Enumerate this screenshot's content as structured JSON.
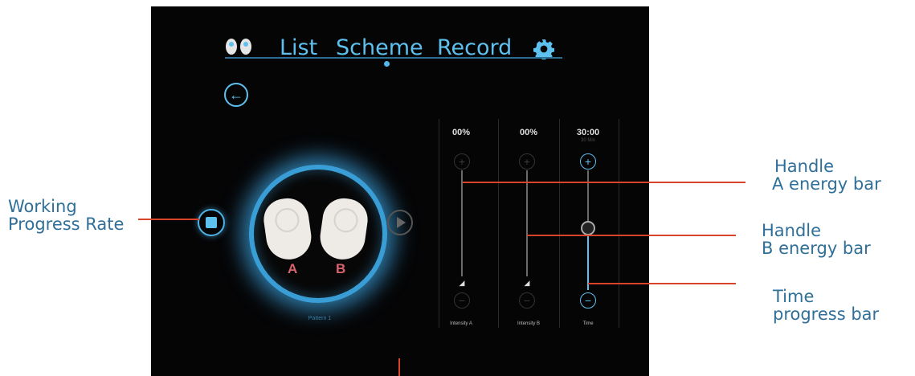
{
  "nav": {
    "pads_icon": "pads-icon",
    "items": [
      "List",
      "Scheme",
      "Record"
    ],
    "settings_icon": "gear-icon"
  },
  "back_icon": "arrow-left-icon",
  "handles": {
    "a_label": "A",
    "b_label": "B"
  },
  "plan_label": "Pattern 1",
  "controls": [
    {
      "value": "00%",
      "label": "Intensity A",
      "level": 0
    },
    {
      "value": "00%",
      "label": "Intensity B",
      "level": 0
    },
    {
      "value": "30:00",
      "sub": "30 Min",
      "label": "Time",
      "progress": 0.5
    }
  ],
  "annotations": {
    "working_progress": [
      "Working",
      "Progress Rate"
    ],
    "handle_a": [
      "Handle",
      "A energy bar"
    ],
    "handle_b": [
      "Handle",
      "B energy bar"
    ],
    "time_progress": [
      "Time",
      "progress bar"
    ]
  },
  "colors": {
    "accent": "#5ec0ee",
    "annotation_line": "#d9432a",
    "annotation_text": "#2f6f98",
    "handle_letter": "#d9636d"
  }
}
